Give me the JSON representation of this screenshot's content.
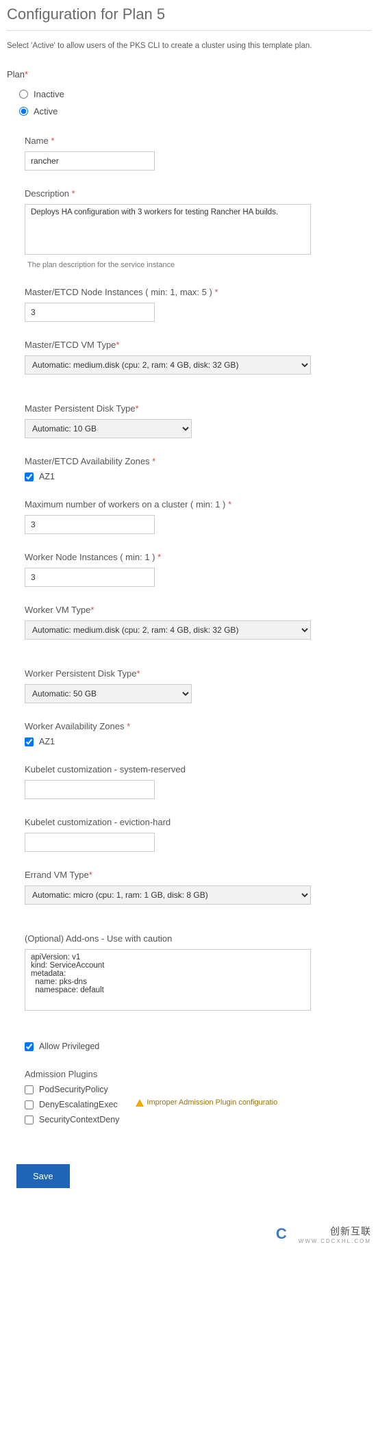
{
  "title": "Configuration for Plan 5",
  "help_text": "Select 'Active' to allow users of the PKS CLI to create a cluster using this template plan.",
  "plan": {
    "label": "Plan",
    "options": {
      "inactive": "Inactive",
      "active": "Active"
    },
    "selected": "active"
  },
  "fields": {
    "name": {
      "label": "Name",
      "value": "rancher"
    },
    "description": {
      "label": "Description",
      "value": "Deploys HA configuration with 3 workers for testing Rancher HA builds.",
      "help": "The plan description for the service instance"
    },
    "master_instances": {
      "label": "Master/ETCD Node Instances   ( min: 1, max: 5 )",
      "value": "3"
    },
    "master_vm_type": {
      "label": "Master/ETCD VM Type",
      "value": "Automatic: medium.disk (cpu: 2, ram: 4 GB, disk: 32 GB)"
    },
    "master_disk_type": {
      "label": "Master Persistent Disk Type",
      "value": "Automatic: 10 GB"
    },
    "master_az": {
      "label": "Master/ETCD Availability Zones",
      "option": "AZ1",
      "checked": true
    },
    "max_workers": {
      "label": "Maximum number of workers on a cluster   ( min: 1 )",
      "value": "3"
    },
    "worker_instances": {
      "label": "Worker Node Instances   ( min: 1 )",
      "value": "3"
    },
    "worker_vm_type": {
      "label": "Worker VM Type",
      "value": "Automatic: medium.disk (cpu: 2, ram: 4 GB, disk: 32 GB)"
    },
    "worker_disk_type": {
      "label": "Worker Persistent Disk Type",
      "value": "Automatic: 50 GB"
    },
    "worker_az": {
      "label": "Worker Availability Zones",
      "option": "AZ1",
      "checked": true
    },
    "kubelet_sys": {
      "label": "Kubelet customization - system-reserved",
      "value": ""
    },
    "kubelet_evict": {
      "label": "Kubelet customization - eviction-hard",
      "value": ""
    },
    "errand_vm": {
      "label": "Errand VM Type",
      "value": "Automatic: micro (cpu: 1, ram: 1 GB, disk: 8 GB)"
    },
    "addons": {
      "label": "(Optional) Add-ons - Use with caution",
      "value": "apiVersion: v1\nkind: ServiceAccount\nmetadata:\n  name: pks-dns\n  namespace: default"
    },
    "allow_priv": {
      "label": "Allow Privileged",
      "checked": true
    },
    "admission": {
      "label": "Admission Plugins",
      "items": [
        {
          "label": "PodSecurityPolicy",
          "checked": false
        },
        {
          "label": "DenyEscalatingExec",
          "checked": false
        },
        {
          "label": "SecurityContextDeny",
          "checked": false
        }
      ],
      "warning": "Improper Admission Plugin configuratio"
    }
  },
  "save_label": "Save",
  "watermark": {
    "brand": "创新互联",
    "sub": "WWW.CDCXHL.COM"
  }
}
